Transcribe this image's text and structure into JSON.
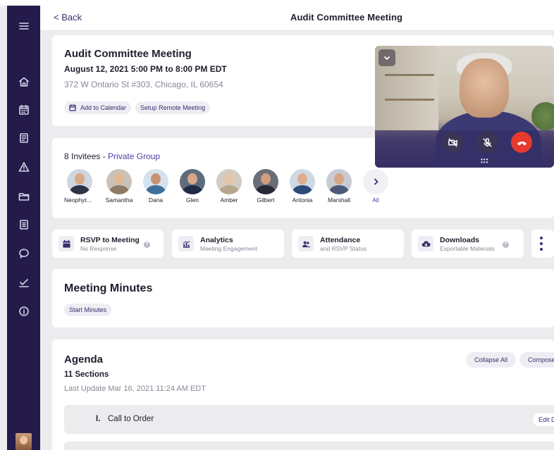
{
  "header": {
    "back_label": "< Back",
    "title": "Audit Committee Meeting"
  },
  "meeting": {
    "title": "Audit Committee Meeting",
    "date": "August 12, 2021 5:00 PM to 8:00 PM EDT",
    "address": "372 W Ontario St #303, Chicago, IL 60654",
    "add_to_calendar_label": "Add to Calendar",
    "setup_remote_label": "Setup Remote Meeting"
  },
  "video": {
    "end_call_color": "#e8392f"
  },
  "invitees": {
    "count_label": "8 Invitees",
    "separator": " - ",
    "group_label": "Private Group",
    "people": [
      "Neophyt...",
      "Samantha",
      "Dana",
      "Glen",
      "Amber",
      "Gilbert",
      "Antonia",
      "Marshall"
    ],
    "all_label": "All"
  },
  "actions": [
    {
      "title": "RSVP to Meeting",
      "subtitle": "No Response",
      "icon": "calendar-icon"
    },
    {
      "title": "Analytics",
      "subtitle": "Meeting Engagement",
      "icon": "chart-icon"
    },
    {
      "title": "Attendance",
      "subtitle": "and RSVP Status",
      "icon": "people-icon"
    },
    {
      "title": "Downloads",
      "subtitle": "Exportable Materials",
      "icon": "cloud-download-icon"
    }
  ],
  "minutes": {
    "title": "Meeting Minutes",
    "start_label": "Start Minutes"
  },
  "agenda": {
    "title": "Agenda",
    "sections": "11 Sections",
    "last_update": "Last Update Mar 16, 2021 11:24 AM EDT",
    "collapse_label": "Collapse All",
    "compose_label": "Compose",
    "items": [
      {
        "number": "I.",
        "label": "Call to Order",
        "edit_label": "Edit D"
      }
    ]
  },
  "colors": {
    "sidebar": "#241b4a",
    "accent": "#3a2f6e",
    "link": "#4b3fa0"
  }
}
